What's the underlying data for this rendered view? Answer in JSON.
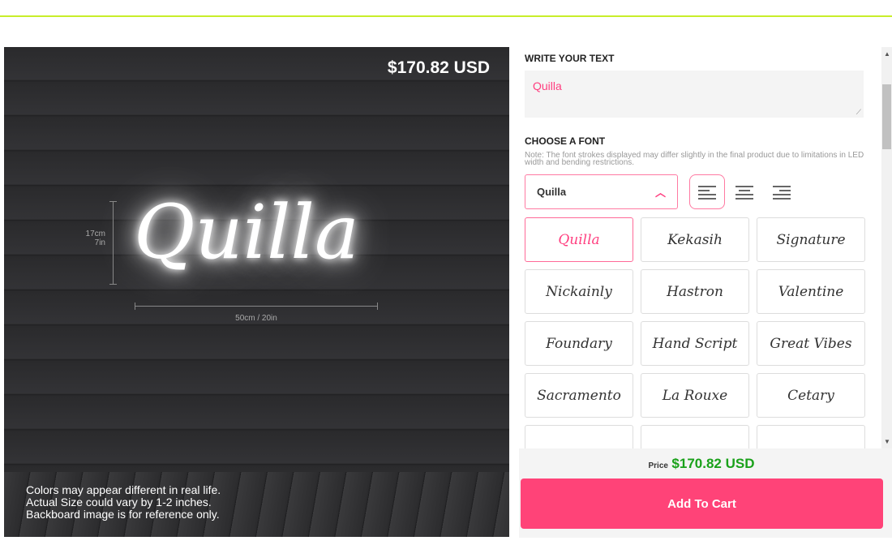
{
  "preview": {
    "price": "$170.82 USD",
    "neon_text": "Quilla",
    "height_label_cm": "17cm",
    "height_label_in": "7in",
    "width_label": "50cm / 20in",
    "notes": [
      "Colors may appear different in real life.",
      "Actual Size could vary by 1-2 inches.",
      "Backboard image is for reference only."
    ]
  },
  "text_section": {
    "heading": "WRITE YOUR TEXT",
    "value": "Quilla"
  },
  "font_section": {
    "heading": "CHOOSE A FONT",
    "note": "Note: The font strokes displayed may differ slightly in the final product due to limitations in LED width and bending restrictions.",
    "selected": "Quilla",
    "alignment": "left",
    "fonts": [
      "Quilla",
      "Kekasih",
      "Signature",
      "Nickainly",
      "Hastron",
      "Valentine",
      "Foundary",
      "Hand Script",
      "Great Vibes",
      "Sacramento",
      "La Rouxe",
      "Cetary"
    ]
  },
  "footer": {
    "price_label": "Price",
    "price": "$170.82 USD",
    "add_to_cart": "Add To Cart"
  },
  "colors": {
    "accent": "#ff4378",
    "price": "#1aa11a",
    "topline": "#c8ee2a"
  }
}
